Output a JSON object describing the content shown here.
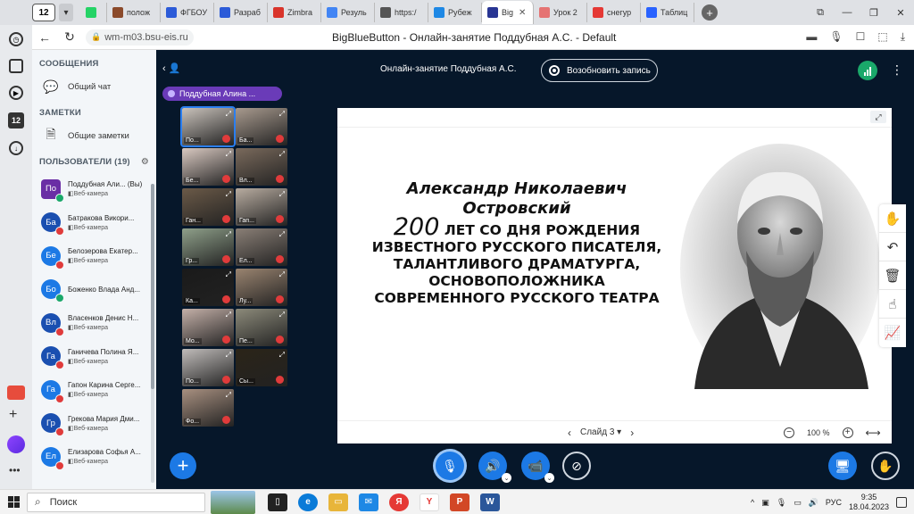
{
  "browser": {
    "tab_count": "12",
    "tabs": [
      {
        "label": "",
        "color": "#25d366"
      },
      {
        "label": "полож",
        "color": "#8b4a2b"
      },
      {
        "label": "ФГБОУ",
        "color": "#2c5bd8"
      },
      {
        "label": "Разраб",
        "color": "#2c5bd8"
      },
      {
        "label": "Zimbra",
        "color": "#d9342b"
      },
      {
        "label": "Резуль",
        "color": "#4285f4"
      },
      {
        "label": "https:/",
        "color": "#555555"
      },
      {
        "label": "Рубеж",
        "color": "#1e88e5"
      },
      {
        "label": "Big",
        "color": "#283593",
        "active": true
      },
      {
        "label": "Урок 2",
        "color": "#e57373"
      },
      {
        "label": "снегур",
        "color": "#e53935"
      },
      {
        "label": "Таблиц",
        "color": "#2962ff"
      }
    ],
    "url": "wm-m03.bsu-eis.ru",
    "page_title": "BigBlueButton - Онлайн-занятие Поддубная А.С. - Default"
  },
  "left_panel": {
    "messages_header": "СООБЩЕНИЯ",
    "public_chat": "Общий чат",
    "notes_header": "ЗАМЕТКИ",
    "shared_notes": "Общие заметки",
    "users_header": "ПОЛЬЗОВАТЕЛИ (19)",
    "users": [
      {
        "initials": "По",
        "name": "Поддубная Али... (Вы)",
        "sub": "Веб-камера",
        "color": "#6a2ea5",
        "status": "#1aa86a",
        "square": true
      },
      {
        "initials": "Ба",
        "name": "Батракова Викори...",
        "sub": "Веб-камера",
        "color": "#1a4fb0",
        "status": "#e03b3b"
      },
      {
        "initials": "Бе",
        "name": "Белозерова Екатер...",
        "sub": "Веб-камера",
        "color": "#1c79e5",
        "status": "#e03b3b"
      },
      {
        "initials": "Бо",
        "name": "Боженко Влада Анд...",
        "sub": "",
        "color": "#1c79e5",
        "status": "#1aa86a"
      },
      {
        "initials": "Вл",
        "name": "Власенков Денис Н...",
        "sub": "Веб-камера",
        "color": "#1a4fb0",
        "status": "#e03b3b"
      },
      {
        "initials": "Га",
        "name": "Ганичева Полина Я...",
        "sub": "Веб-камера",
        "color": "#1a4fb0",
        "status": "#e03b3b"
      },
      {
        "initials": "Га",
        "name": "Гапон Карина Серге...",
        "sub": "Веб-камера",
        "color": "#1c79e5",
        "status": "#e03b3b"
      },
      {
        "initials": "Гр",
        "name": "Грекова Мария Дми...",
        "sub": "Веб-камера",
        "color": "#1a4fb0",
        "status": "#e03b3b"
      },
      {
        "initials": "Ел",
        "name": "Елизарова Софья А...",
        "sub": "Веб-камера",
        "color": "#1c79e5",
        "status": "#e03b3b"
      }
    ]
  },
  "meeting": {
    "title": "Онлайн-занятие Поддубная А.С.",
    "record_label": "Возобновить запись",
    "talking_user": "Поддубная Алина ..."
  },
  "videos": [
    {
      "label": "По...",
      "bg": "#c9c2bb",
      "selected": true
    },
    {
      "label": "Ба...",
      "bg": "#a89a8e"
    },
    {
      "label": "Бе...",
      "bg": "#d9c9c1"
    },
    {
      "label": "Вл...",
      "bg": "#7a6a5c"
    },
    {
      "label": "Ган...",
      "bg": "#6b5a48"
    },
    {
      "label": "Гап...",
      "bg": "#b8aca0"
    },
    {
      "label": "Гр...",
      "bg": "#8fa08a"
    },
    {
      "label": "Ел...",
      "bg": "#8a7f76"
    },
    {
      "label": "Ка...",
      "bg": "#1a1a1a"
    },
    {
      "label": "Лу...",
      "bg": "#9a8470"
    },
    {
      "label": "Мо...",
      "bg": "#c4b0a8"
    },
    {
      "label": "Пе...",
      "bg": "#8c8a7a"
    },
    {
      "label": "По...",
      "bg": "#c0bcba"
    },
    {
      "label": "Сы...",
      "bg": "#2b2418"
    },
    {
      "label": "Фо...",
      "bg": "#a89080"
    }
  ],
  "slide": {
    "heading": "Александр Николаевич Островский",
    "number": "200",
    "body": "ЛЕТ СО ДНЯ РОЖДЕНИЯ ИЗВЕСТНОГО РУССКОГО ПИСАТЕЛЯ, ТАЛАНТЛИВОГО ДРАМАТУРГА, ОСНОВОПОЛОЖНИКА СОВРЕМЕННОГО РУССКОГО ТЕАТРА",
    "slide_label": "Слайд 3",
    "zoom": "100 %"
  },
  "taskbar": {
    "search_placeholder": "Поиск",
    "lang": "РУС",
    "time": "9:35",
    "date": "18.04.2023"
  }
}
